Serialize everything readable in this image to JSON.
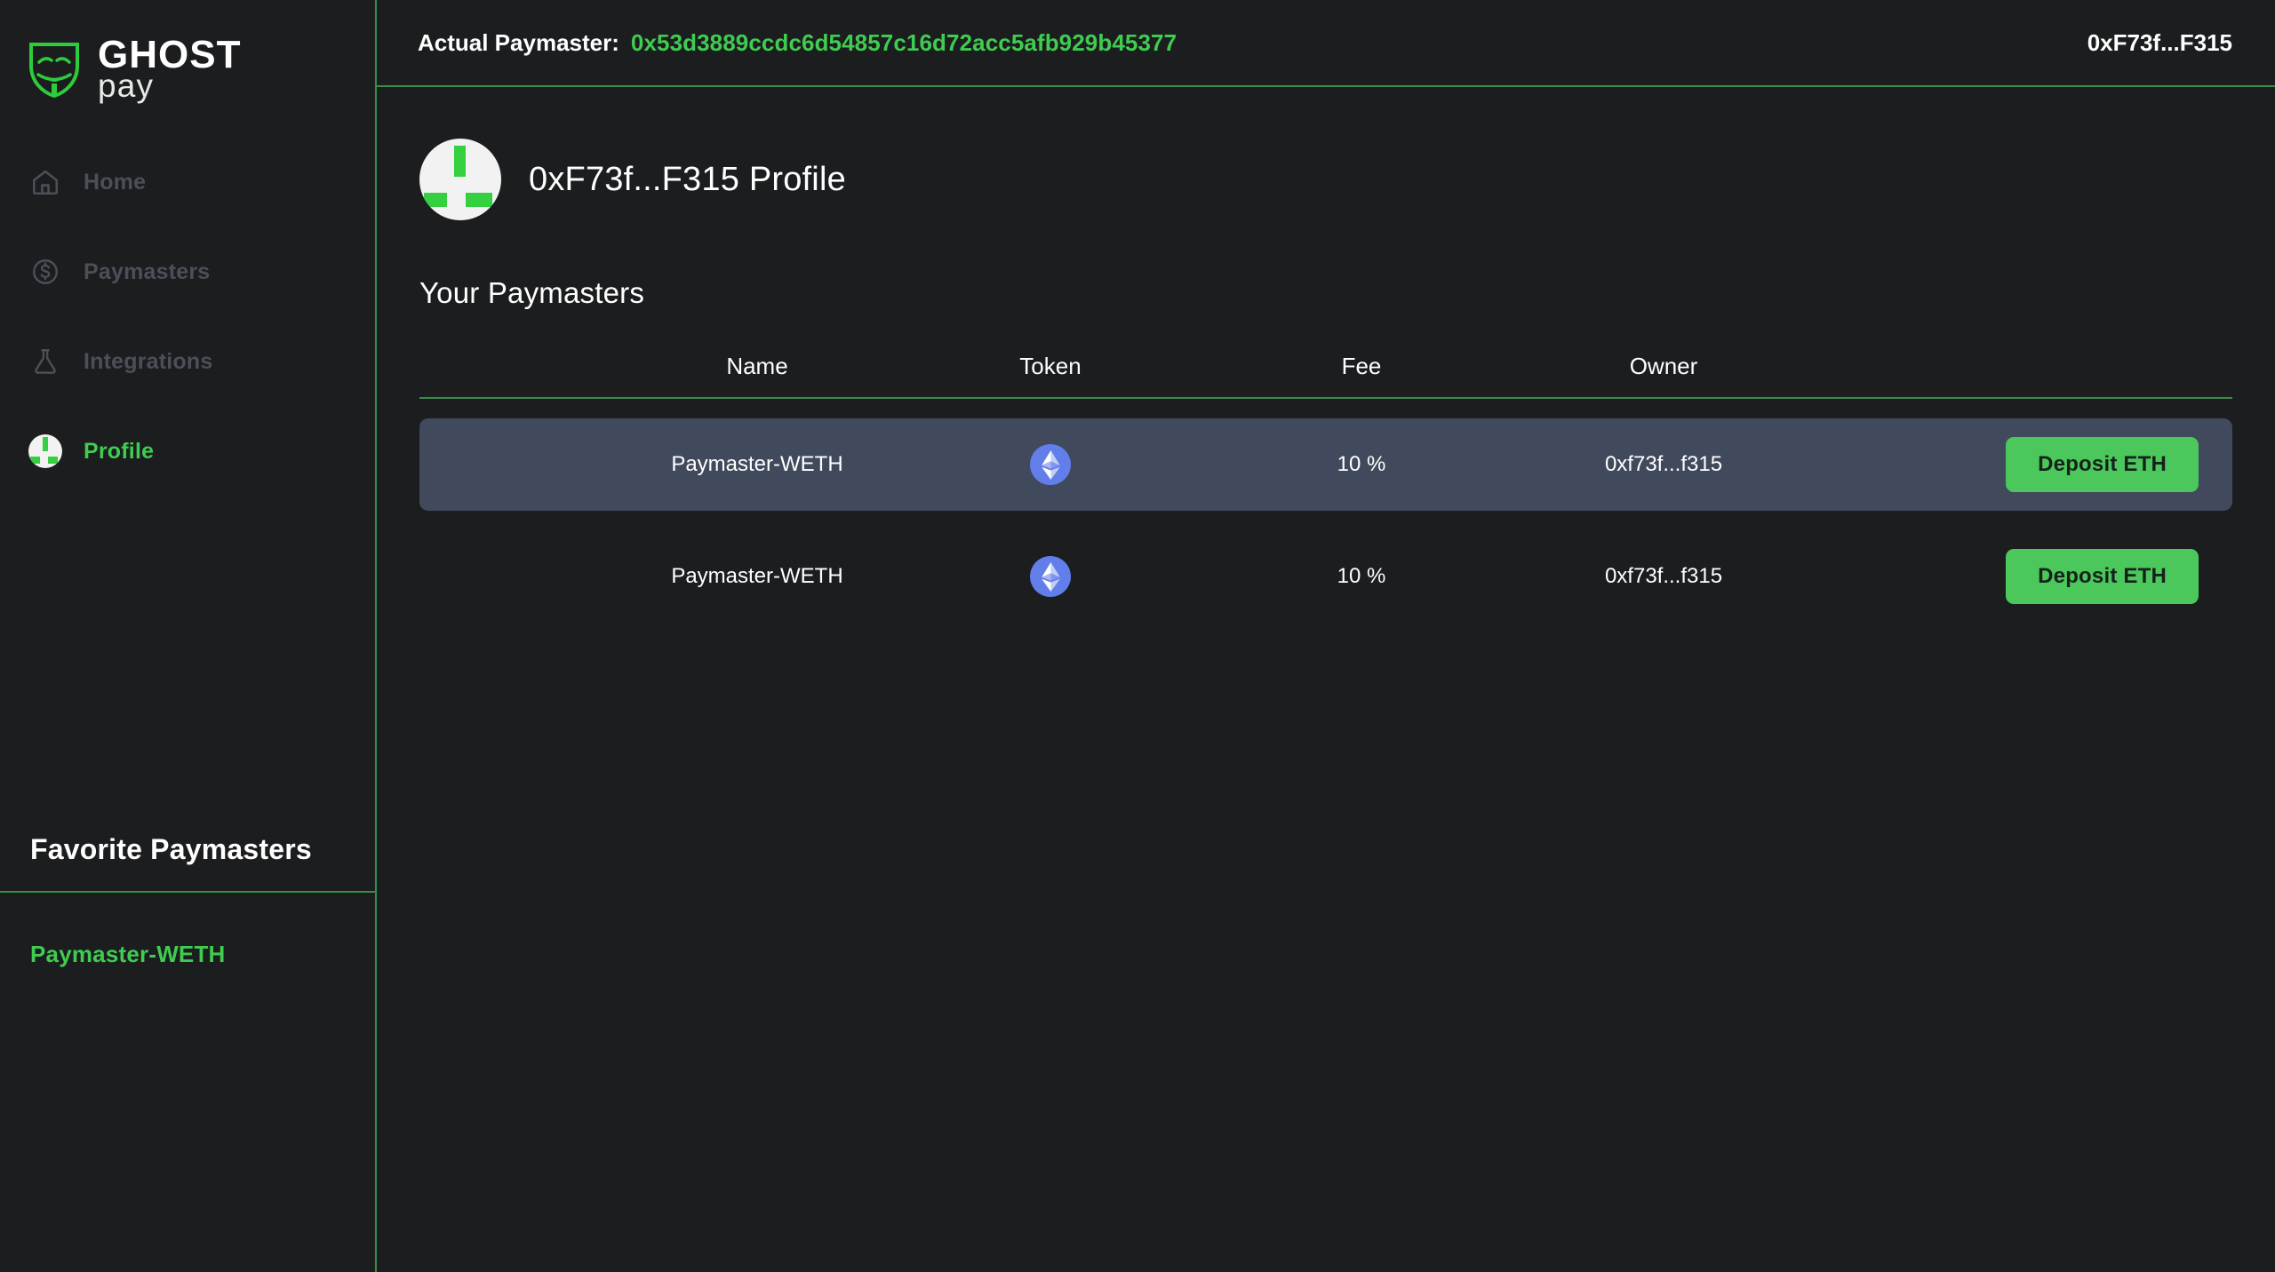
{
  "brand": {
    "name_top": "GHOST",
    "name_bottom": "pay",
    "logo_icon": "ghost-mask-icon"
  },
  "sidebar": {
    "items": [
      {
        "label": "Home",
        "icon": "home-icon",
        "active": false
      },
      {
        "label": "Paymasters",
        "icon": "dollar-circle-icon",
        "active": false
      },
      {
        "label": "Integrations",
        "icon": "flask-icon",
        "active": false
      },
      {
        "label": "Profile",
        "icon": "avatar-icon",
        "active": true
      }
    ],
    "favorites": {
      "title": "Favorite Paymasters",
      "items": [
        "Paymaster-WETH"
      ]
    }
  },
  "topbar": {
    "label": "Actual Paymaster:",
    "address": "0x53d3889ccdc6d54857c16d72acc5afb929b45377",
    "wallet": "0xF73f...F315"
  },
  "profile": {
    "title": "0xF73f...F315 Profile",
    "avatar_icon": "identicon-avatar"
  },
  "main": {
    "section_title": "Your Paymasters",
    "table": {
      "columns": [
        "",
        "Name",
        "Token",
        "Fee",
        "Owner",
        ""
      ],
      "rows": [
        {
          "name": "Paymaster-WETH",
          "token": "ETH",
          "token_icon": "ethereum-icon",
          "fee": "10 %",
          "owner": "0xf73f...f315",
          "action": "Deposit ETH",
          "highlighted": true
        },
        {
          "name": "Paymaster-WETH",
          "token": "ETH",
          "token_icon": "ethereum-icon",
          "fee": "10 %",
          "owner": "0xf73f...f315",
          "action": "Deposit ETH",
          "highlighted": false
        }
      ]
    }
  },
  "colors": {
    "background": "#1b1d1f",
    "accent_green": "#3fcc50",
    "border_green": "#3a8c4a",
    "button_green": "#4cc75c",
    "row_highlight": "#414a5c",
    "eth_blue": "#627eea",
    "muted_text": "#4b5058"
  }
}
